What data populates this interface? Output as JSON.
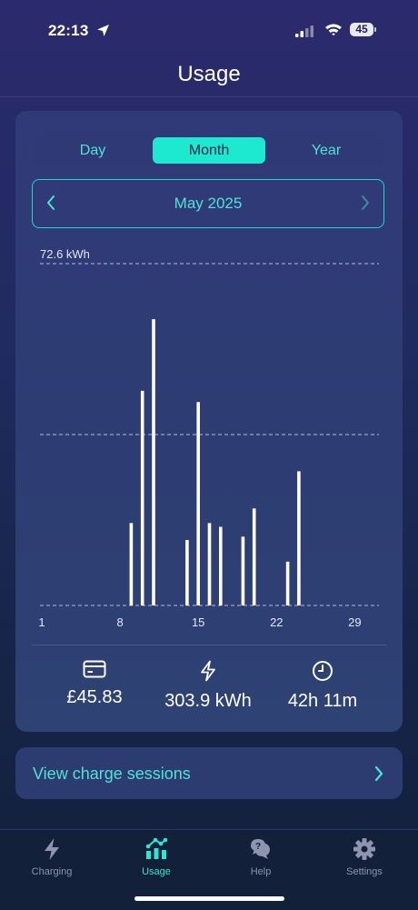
{
  "status_bar": {
    "time": "22:13",
    "battery": "45"
  },
  "header": {
    "title": "Usage"
  },
  "period_tabs": [
    {
      "label": "Day",
      "active": false
    },
    {
      "label": "Month",
      "active": true
    },
    {
      "label": "Year",
      "active": false
    }
  ],
  "date_nav": {
    "label": "May 2025"
  },
  "chart_data": {
    "type": "bar",
    "max_label": "72.6 kWh",
    "ylim": [
      0,
      72.6
    ],
    "gridlines": [
      0,
      36.3,
      72.6
    ],
    "x_ticks": [
      "1",
      "8",
      "15",
      "22",
      "29"
    ],
    "x": [
      9,
      10,
      11,
      14,
      15,
      16,
      17,
      19,
      20,
      23,
      24
    ],
    "values": [
      17.5,
      45.6,
      60.8,
      13.9,
      43.2,
      17.5,
      16.7,
      14.6,
      20.6,
      9.3,
      28.5
    ],
    "bar_color": "#ffffff"
  },
  "stats": {
    "cost": {
      "icon": "card-icon",
      "value": "£45.83"
    },
    "energy": {
      "icon": "lightning-icon",
      "value": "303.9 kWh"
    },
    "duration": {
      "icon": "clock-icon",
      "value": "42h 11m"
    }
  },
  "sessions": {
    "label": "View charge sessions"
  },
  "tab_bar": [
    {
      "label": "Charging",
      "icon": "lightning-icon",
      "active": false
    },
    {
      "label": "Usage",
      "icon": "usage-chart-icon",
      "active": true
    },
    {
      "label": "Help",
      "icon": "help-chat-icon",
      "active": false
    },
    {
      "label": "Settings",
      "icon": "gear-icon",
      "active": false
    }
  ],
  "colors": {
    "accent": "#1de8d0",
    "accent_text": "#4fe3d3",
    "muted": "#8e95ad"
  }
}
